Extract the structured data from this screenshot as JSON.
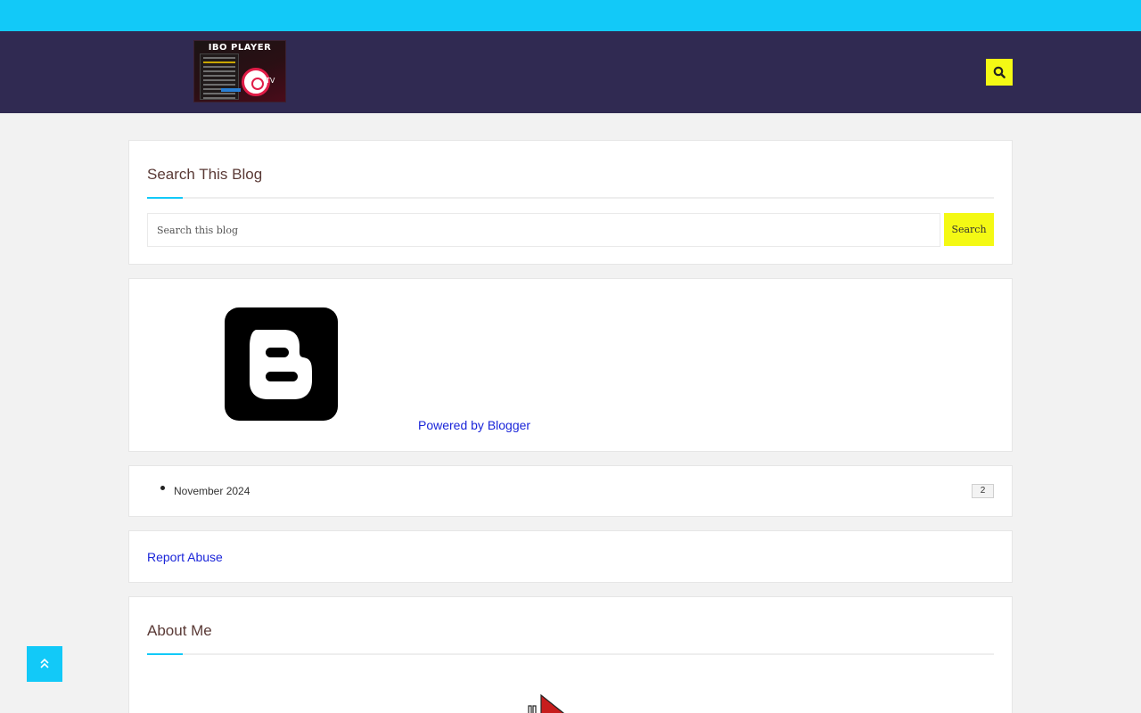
{
  "header": {
    "logo_text": "IBO PLAYER",
    "logo_tv_text": "TV",
    "search_icon": "search-icon",
    "colors": {
      "topbar": "#12c9f8",
      "header": "#302a52",
      "accent": "#f4f914"
    }
  },
  "search_widget": {
    "title": "Search This Blog",
    "input_placeholder": "Search this blog",
    "button_label": "Search"
  },
  "blogger_widget": {
    "icon": "blogger-icon",
    "powered_by": "Powered by Blogger"
  },
  "archive_widget": {
    "items": [
      {
        "label": "November 2024",
        "count": "2"
      }
    ]
  },
  "report_widget": {
    "label": "Report Abuse"
  },
  "about_widget": {
    "title": "About Me"
  },
  "back_to_top": {
    "icon": "double-chevron-up-icon"
  }
}
